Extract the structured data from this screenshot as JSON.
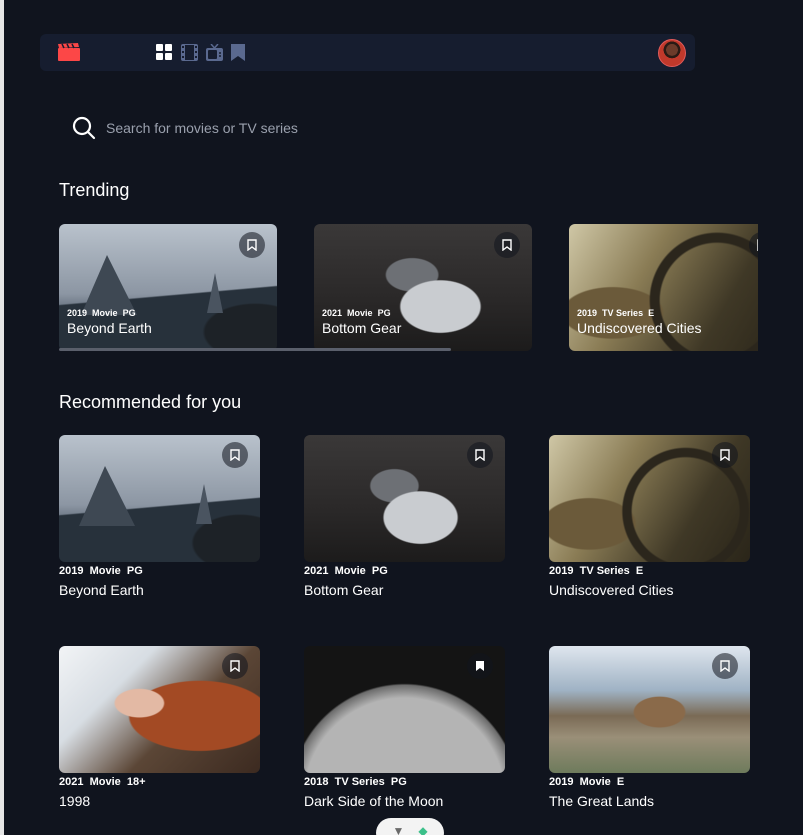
{
  "nav": {
    "logo_icon": "movie-clapper-icon",
    "items": [
      {
        "name": "home-grid-icon",
        "active": true
      },
      {
        "name": "movies-film-icon",
        "active": false
      },
      {
        "name": "tv-series-icon",
        "active": false
      },
      {
        "name": "bookmark-nav-icon",
        "active": false
      }
    ]
  },
  "search": {
    "placeholder": "Search for movies or TV series"
  },
  "trending": {
    "title": "Trending",
    "items": [
      {
        "year": "2019",
        "category": "Movie",
        "rating": "PG",
        "title": "Beyond Earth",
        "image": "mountain"
      },
      {
        "year": "2021",
        "category": "Movie",
        "rating": "PG",
        "title": "Bottom Gear",
        "image": "car"
      },
      {
        "year": "2019",
        "category": "TV Series",
        "rating": "E",
        "title": "Undiscovered Cities",
        "image": "wheel"
      }
    ]
  },
  "recommended": {
    "title": "Recommended for you",
    "items": [
      {
        "year": "2019",
        "category": "Movie",
        "rating": "PG",
        "title": "Beyond Earth",
        "image": "mountain",
        "bookmarked": false
      },
      {
        "year": "2021",
        "category": "Movie",
        "rating": "PG",
        "title": "Bottom Gear",
        "image": "car",
        "bookmarked": false
      },
      {
        "year": "2019",
        "category": "TV Series",
        "rating": "E",
        "title": "Undiscovered Cities",
        "image": "wheel",
        "bookmarked": false
      },
      {
        "year": "2021",
        "category": "Movie",
        "rating": "18+",
        "title": "1998",
        "image": "girl",
        "bookmarked": false
      },
      {
        "year": "2018",
        "category": "TV Series",
        "rating": "PG",
        "title": "Dark Side of the Moon",
        "image": "moon",
        "bookmarked": true
      },
      {
        "year": "2019",
        "category": "Movie",
        "rating": "E",
        "title": "The Great Lands",
        "image": "landscape",
        "bookmarked": false
      }
    ]
  },
  "colors": {
    "background": "#10141e",
    "nav": "#161d2f",
    "accent": "#fc4747",
    "nav_icon": "#5a698f"
  }
}
